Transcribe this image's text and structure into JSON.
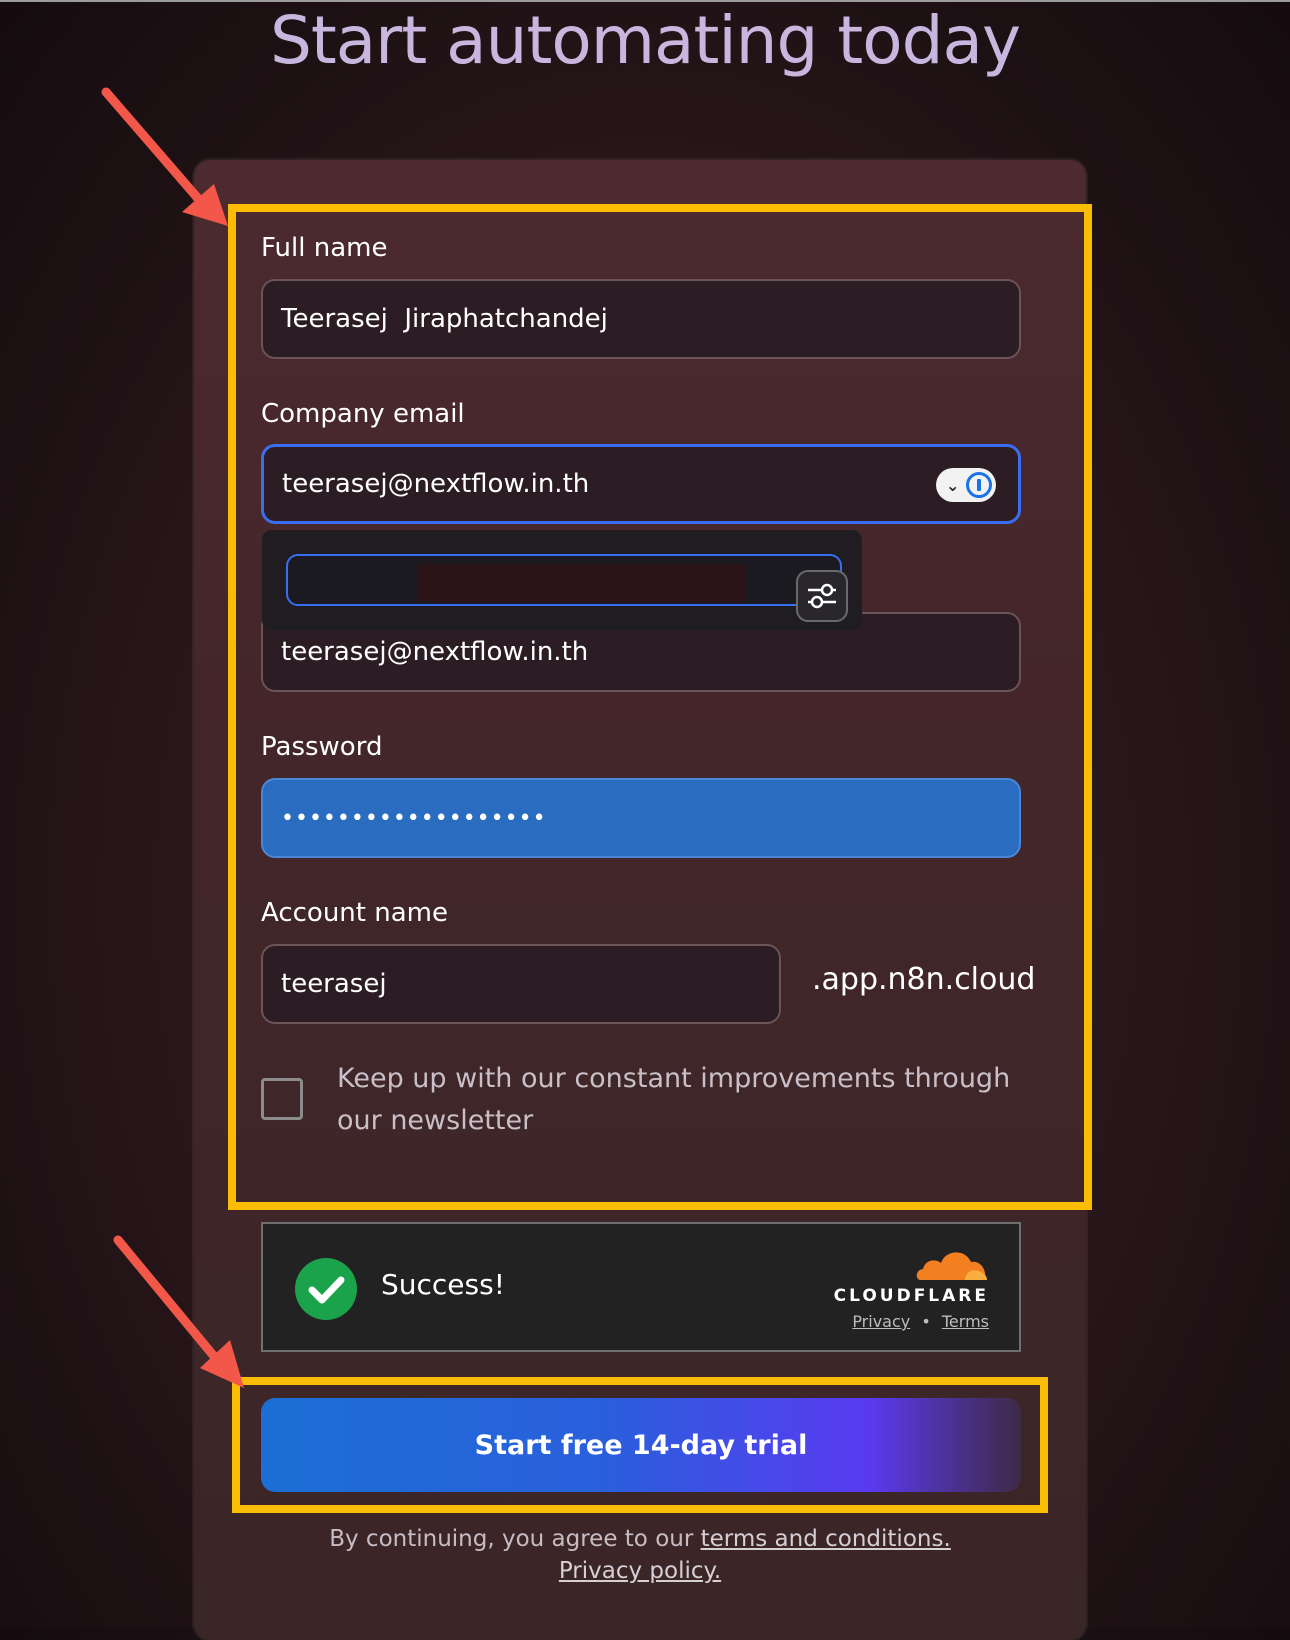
{
  "page": {
    "title": "Start automating today"
  },
  "form": {
    "full_name": {
      "label": "Full name",
      "value": "Teerasej  Jiraphatchandej"
    },
    "company_email": {
      "label": "Company email",
      "value": "teerasej@nextflow.in.th"
    },
    "confirm_email": {
      "value": "teerasej@nextflow.in.th"
    },
    "password": {
      "label": "Password",
      "value": "•••••••••••••••••••"
    },
    "account_name": {
      "label": "Account name",
      "value": "teerasej",
      "suffix": ".app.n8n.cloud"
    },
    "newsletter": {
      "label": "Keep up with our constant improvements through our newsletter",
      "checked": false
    }
  },
  "captcha": {
    "status": "Success!",
    "brand": "CLOUDFLARE",
    "privacy_link": "Privacy",
    "separator": "•",
    "terms_link": "Terms"
  },
  "cta": {
    "label": "Start free 14-day trial"
  },
  "legal": {
    "prefix": "By continuing, you agree to our",
    "terms_link": "terms and conditions.",
    "privacy_link": "Privacy policy."
  },
  "colors": {
    "highlight": "#fbbc05",
    "arrow": "#f2574a",
    "focus": "#3a6df0",
    "success": "#1aa34a"
  },
  "icons": [
    "password-manager-icon",
    "chevron-down-icon",
    "settings-sliders-icon",
    "checkmark-icon",
    "cloudflare-cloud-icon",
    "annotation-arrow-icon"
  ]
}
